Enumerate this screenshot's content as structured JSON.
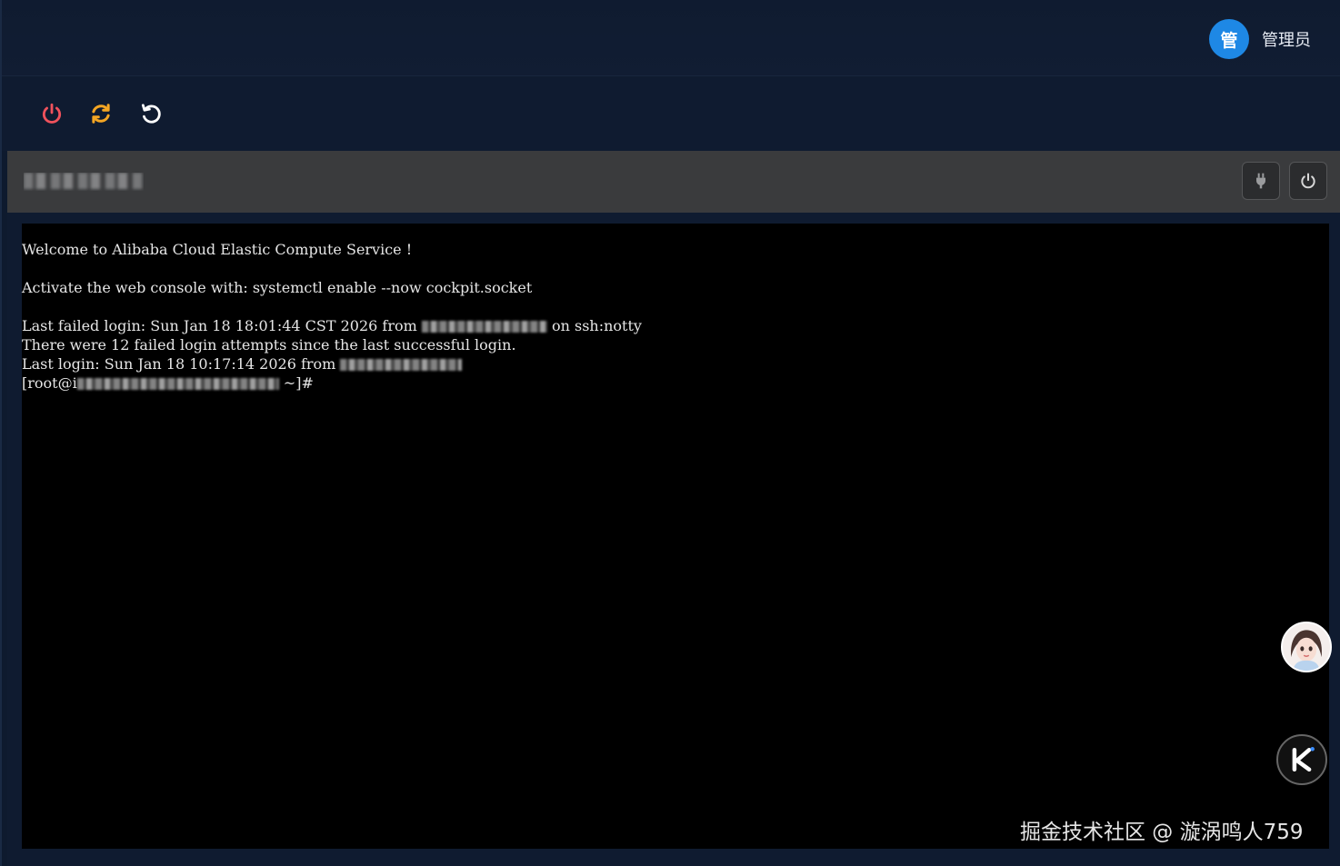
{
  "header": {
    "avatar_char": "管",
    "user_name": "管理员",
    "avatar_color": "#1e88e5"
  },
  "toolbar": {
    "buttons": [
      {
        "name": "power-icon",
        "color": "#f0525c"
      },
      {
        "name": "sync-icon",
        "color": "#f5a623"
      },
      {
        "name": "undo-icon",
        "color": "#ffffff"
      }
    ]
  },
  "session": {
    "title": "",
    "buttons": [
      {
        "name": "plug-icon"
      },
      {
        "name": "power-icon"
      }
    ]
  },
  "terminal": {
    "welcome": "Welcome to Alibaba Cloud Elastic Compute Service !",
    "activate": "Activate the web console with: systemctl enable --now cockpit.socket",
    "failed_prefix": "Last failed login: Sun Jan 18 18:01:44 CST 2026 from ",
    "failed_suffix": " on ssh:notty",
    "attempts": "There were 12 failed login attempts since the last successful login.",
    "last_login_prefix": "Last login: Sun Jan 18 10:17:14 2026 from ",
    "prompt_prefix": "[root@i",
    "prompt_suffix": " ~]#"
  },
  "watermark": "掘金技术社区 @ 漩涡鸣人759"
}
